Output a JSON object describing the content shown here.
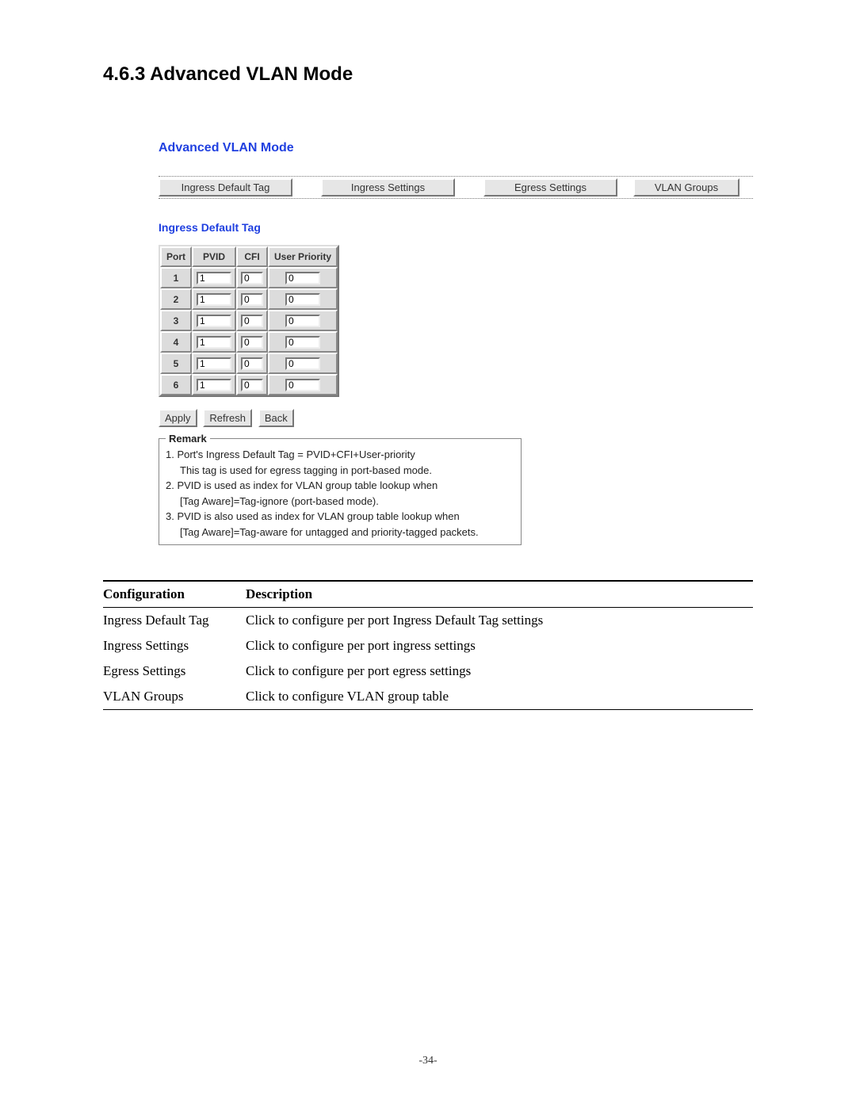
{
  "heading": "4.6.3 Advanced VLAN Mode",
  "gui": {
    "title": "Advanced VLAN Mode",
    "tabs": {
      "ingress_default_tag": "Ingress Default Tag",
      "ingress_settings": "Ingress Settings",
      "egress_settings": "Egress Settings",
      "vlan_groups": "VLAN Groups"
    },
    "section_title": "Ingress Default Tag",
    "table": {
      "headers": {
        "port": "Port",
        "pvid": "PVID",
        "cfi": "CFI",
        "user_priority": "User Priority"
      },
      "rows": [
        {
          "port": "1",
          "pvid": "1",
          "cfi": "0",
          "up": "0"
        },
        {
          "port": "2",
          "pvid": "1",
          "cfi": "0",
          "up": "0"
        },
        {
          "port": "3",
          "pvid": "1",
          "cfi": "0",
          "up": "0"
        },
        {
          "port": "4",
          "pvid": "1",
          "cfi": "0",
          "up": "0"
        },
        {
          "port": "5",
          "pvid": "1",
          "cfi": "0",
          "up": "0"
        },
        {
          "port": "6",
          "pvid": "1",
          "cfi": "0",
          "up": "0"
        }
      ]
    },
    "buttons": {
      "apply": "Apply",
      "refresh": "Refresh",
      "back": "Back"
    },
    "remark": {
      "title": "Remark",
      "l1": "1. Port's Ingress Default Tag = PVID+CFI+User-priority",
      "l1a": "This tag is used for egress tagging in port-based mode.",
      "l2": "2. PVID is used as index for VLAN group table lookup when",
      "l2a": "[Tag Aware]=Tag-ignore (port-based mode).",
      "l3": "3. PVID is also used as index for VLAN group table lookup when",
      "l3a": "[Tag Aware]=Tag-aware for untagged and priority-tagged packets."
    }
  },
  "config_table": {
    "head": {
      "configuration": "Configuration",
      "description": "Description"
    },
    "rows": [
      {
        "conf": "Ingress Default Tag",
        "desc": "Click to configure per port Ingress Default Tag settings"
      },
      {
        "conf": "Ingress Settings",
        "desc": "Click to configure per port ingress settings"
      },
      {
        "conf": "Egress Settings",
        "desc": "Click to configure per port egress settings"
      },
      {
        "conf": "VLAN Groups",
        "desc": "Click to configure VLAN group table"
      }
    ]
  },
  "page_number": "-34-"
}
